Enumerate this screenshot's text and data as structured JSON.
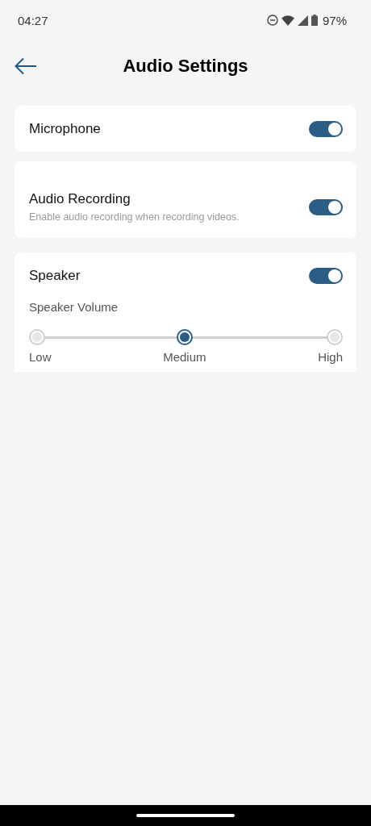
{
  "status_bar": {
    "time": "04:27",
    "battery": "97%"
  },
  "header": {
    "title": "Audio Settings"
  },
  "cards": [
    {
      "kind": "toggle",
      "label": "Microphone",
      "on": true
    },
    {
      "kind": "toggle",
      "label": "Audio Recording",
      "description": "Enable audio recording when recording videos.",
      "on": true
    },
    {
      "kind": "speaker",
      "label": "Speaker",
      "on": true,
      "volume": {
        "label": "Speaker Volume",
        "options": [
          {
            "label": "Low",
            "selected": false
          },
          {
            "label": "Medium",
            "selected": true
          },
          {
            "label": "High",
            "selected": false
          }
        ]
      }
    }
  ]
}
